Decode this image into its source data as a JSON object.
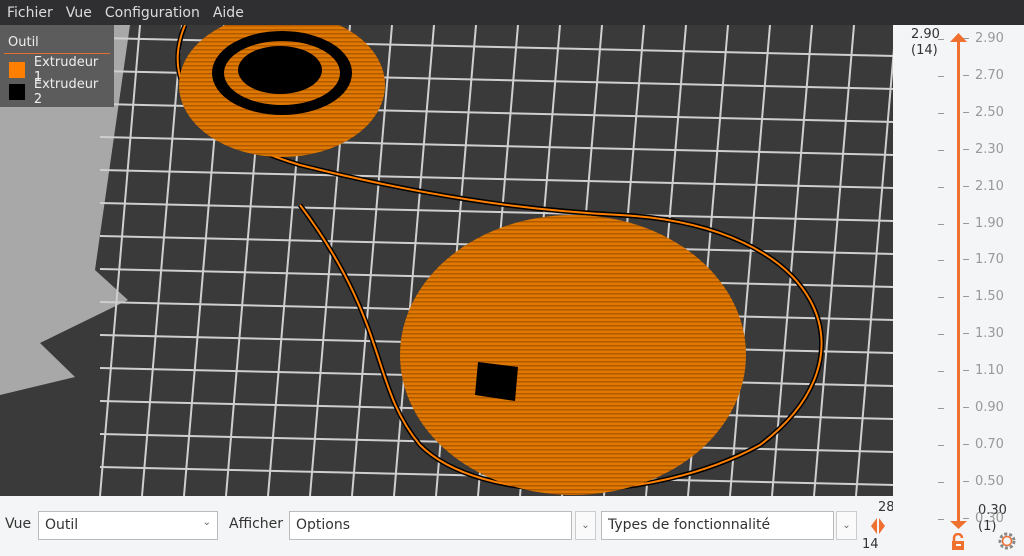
{
  "menu": [
    "Fichier",
    "Vue",
    "Configuration",
    "Aide"
  ],
  "legend": {
    "title": "Outil",
    "items": [
      {
        "label": "Extrudeur 1",
        "color": "#ff8000"
      },
      {
        "label": "Extrudeur 2",
        "color": "#000000"
      }
    ]
  },
  "bottom": {
    "view_label": "Vue",
    "view_value": "Outil",
    "show_label": "Afficher",
    "options_value": "Options",
    "features_value": "Types de fonctionnalité",
    "h_max": "28",
    "h_min": "14"
  },
  "layers": {
    "top_value": "2.90",
    "top_index": "(14)",
    "bottom_value": "0.30",
    "bottom_index": "(1)",
    "ticks": [
      "2.90",
      "2.70",
      "2.50",
      "2.30",
      "2.10",
      "1.90",
      "1.70",
      "1.50",
      "1.30",
      "1.10",
      "0.90",
      "0.70",
      "0.50",
      "0.30"
    ]
  },
  "colors": {
    "accent": "#f07030"
  }
}
